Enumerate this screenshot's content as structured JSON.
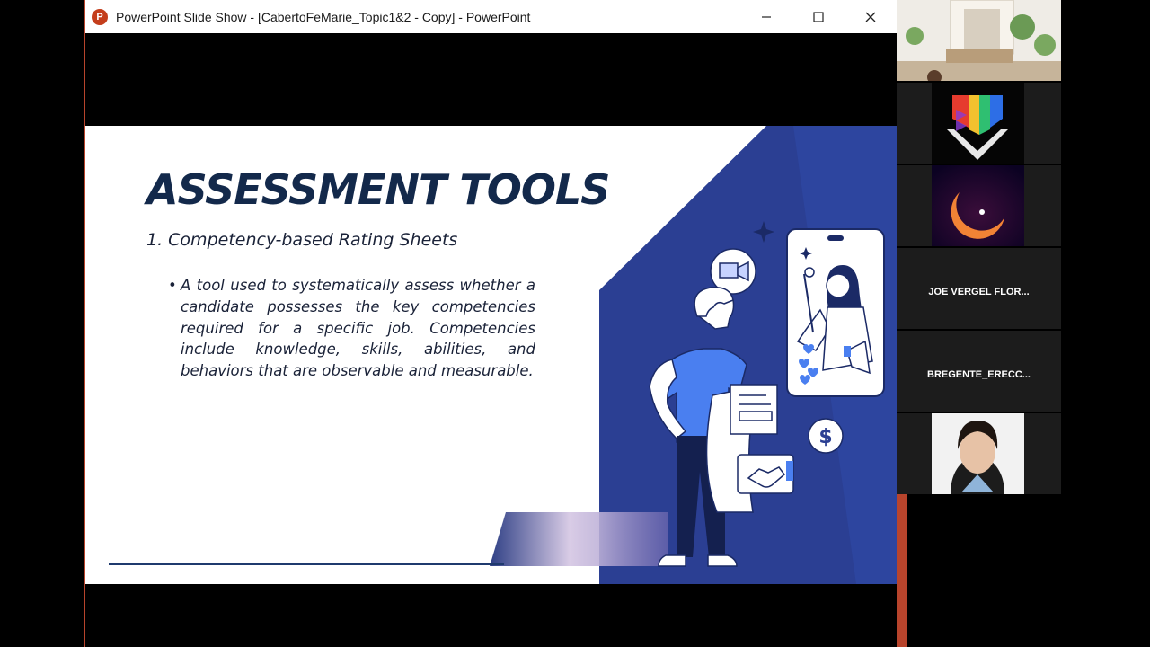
{
  "window": {
    "title": "PowerPoint Slide Show - [CabertoFeMarie_Topic1&2 - Copy] - PowerPoint",
    "app_icon_letter": "P",
    "controls": [
      "minimize-icon",
      "maximize-icon",
      "close-icon"
    ]
  },
  "slide": {
    "title": "ASSESSMENT TOOLS",
    "subtitle": "1. Competency-based Rating Sheets",
    "bullet_symbol": "•",
    "bullet": "A tool used to systematically assess whether a candidate possesses the key competencies required for a specific job. Competencies include knowledge, skills, abilities, and behaviors that are observable and measurable.",
    "illustration_icons": [
      "video-camera-icon",
      "dollar-coin-icon",
      "handshake-icon",
      "sparkle-icon",
      "heart-icon",
      "megaphone-icon"
    ],
    "colors": {
      "title": "#13294b",
      "accent_panel": "#2b3f93",
      "person_shirt": "#4a7ff0"
    }
  },
  "participants": [
    {
      "type": "video-room",
      "name": ""
    },
    {
      "type": "logo",
      "name": ""
    },
    {
      "type": "moon-image",
      "name": ""
    },
    {
      "type": "name-only",
      "name": "JOE VERGEL FLOR..."
    },
    {
      "type": "name-only",
      "name": "BREGENTE_ERECC..."
    },
    {
      "type": "video-person",
      "name": ""
    }
  ]
}
